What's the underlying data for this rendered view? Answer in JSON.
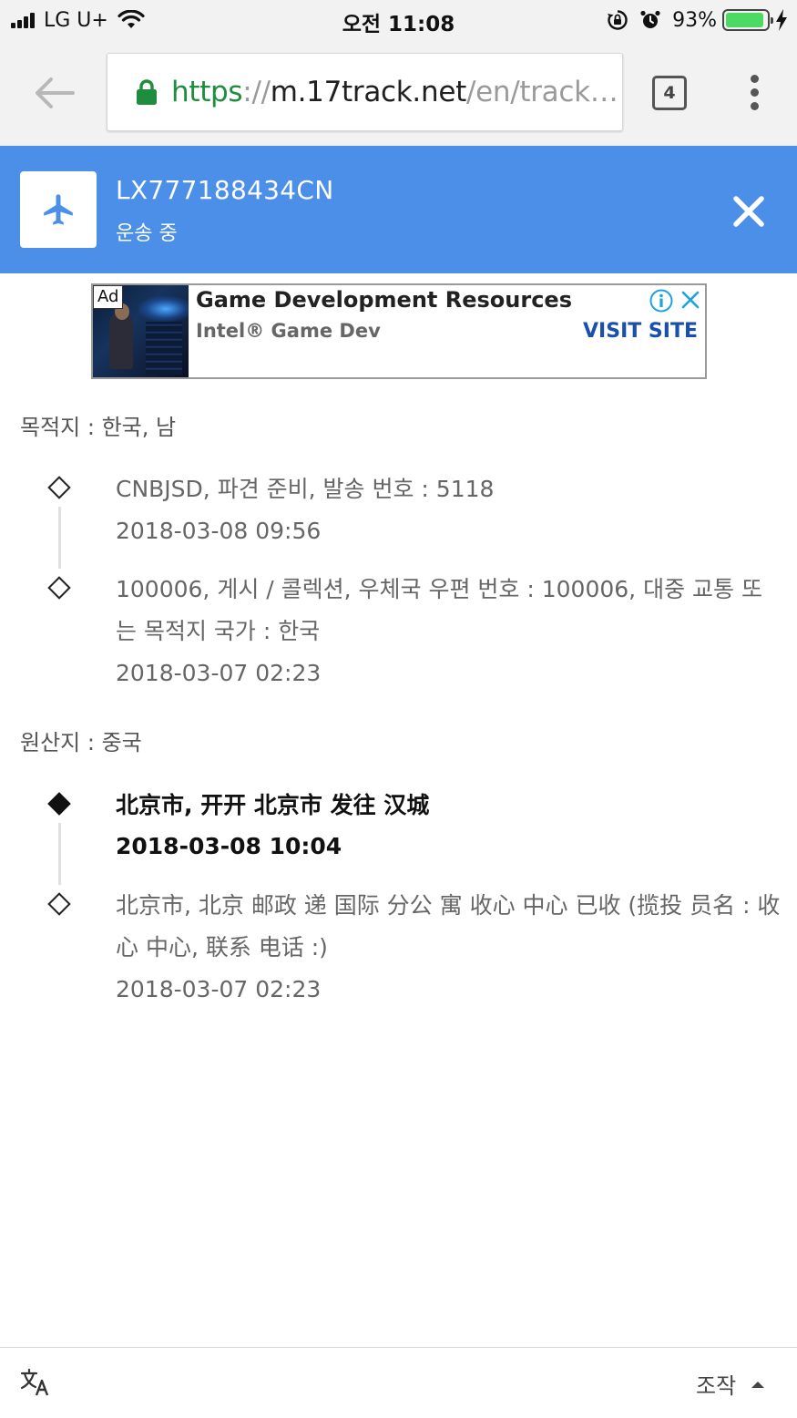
{
  "status_bar": {
    "carrier": "LG U+",
    "time": "오전 11:08",
    "battery_percent": "93%",
    "battery_level": 0.93
  },
  "browser": {
    "url_scheme": "https",
    "url_sep": "://",
    "url_host": "m.17track.net",
    "url_path": "/en/track…",
    "tab_count": "4"
  },
  "tracking": {
    "number": "LX777188434CN",
    "status": "운송 중"
  },
  "ad": {
    "badge": "Ad",
    "title": "Game Development Resources",
    "advertiser": "Intel® Game Dev",
    "cta": "VISIT SITE"
  },
  "destination": {
    "label": "목적지 : 한국, 남",
    "events": [
      {
        "text": "CNBJSD, 파견 준비, 발송 번호 : 5118",
        "time": "2018-03-08 09:56"
      },
      {
        "text": "100006, 게시 / 콜렉션, 우체국 우편 번호 : 100006, 대중 교통 또는 목적지 국가 : 한국",
        "time": "2018-03-07 02:23"
      }
    ]
  },
  "origin": {
    "label": "원산지 : 중국",
    "events": [
      {
        "text": "北京市, 开开 北京市 发往 汉城",
        "time": "2018-03-08 10:04"
      },
      {
        "text": "北京市, 北京 邮政 递 国际 分公 寓 收心 中心 已收 (揽投 员名 : 收心 中心, 联系 电话 :)",
        "time": "2018-03-07 02:23"
      }
    ]
  },
  "bottom_bar": {
    "controls_label": "조작"
  },
  "colors": {
    "header_blue": "#4b8fe8",
    "url_green": "#1e8e3e",
    "ad_link": "#1a4fb0"
  }
}
